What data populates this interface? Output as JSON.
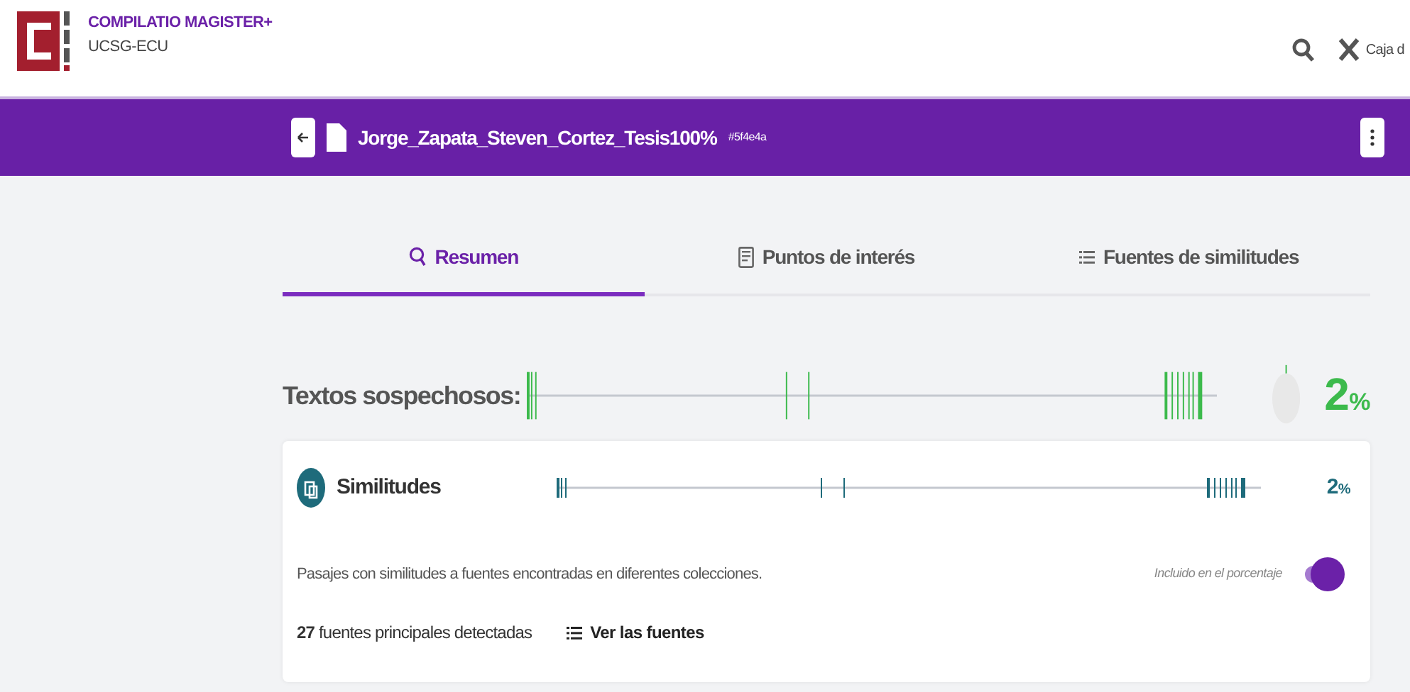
{
  "header": {
    "brand_title": "COMPILATIO MAGISTER+",
    "brand_subtitle": "UCSG-ECU",
    "toolbox_label": "Caja d"
  },
  "document": {
    "title": "Jorge_Zapata_Steven_Cortez_Tesis100%",
    "hash": "#5f4e4a"
  },
  "tabs": [
    {
      "label": "Resumen",
      "kind": "summary",
      "selected": true
    },
    {
      "label": "Puntos de interés",
      "kind": "points",
      "selected": false
    },
    {
      "label": "Fuentes de similitudes",
      "kind": "sources",
      "selected": false
    }
  ],
  "suspicious": {
    "label": "Textos sospechosos:",
    "value": "2",
    "unit": "%"
  },
  "similarities": {
    "title": "Similitudes",
    "value": "2",
    "unit": "%",
    "description": "Pasajes con similitudes a fuentes encontradas en diferentes colecciones.",
    "toggle_label": "Incluido en el porcentaje",
    "toggle_on": true,
    "sources_count": "27",
    "sources_text": "fuentes principales detectadas",
    "sources_link": "Ver las fuentes"
  }
}
